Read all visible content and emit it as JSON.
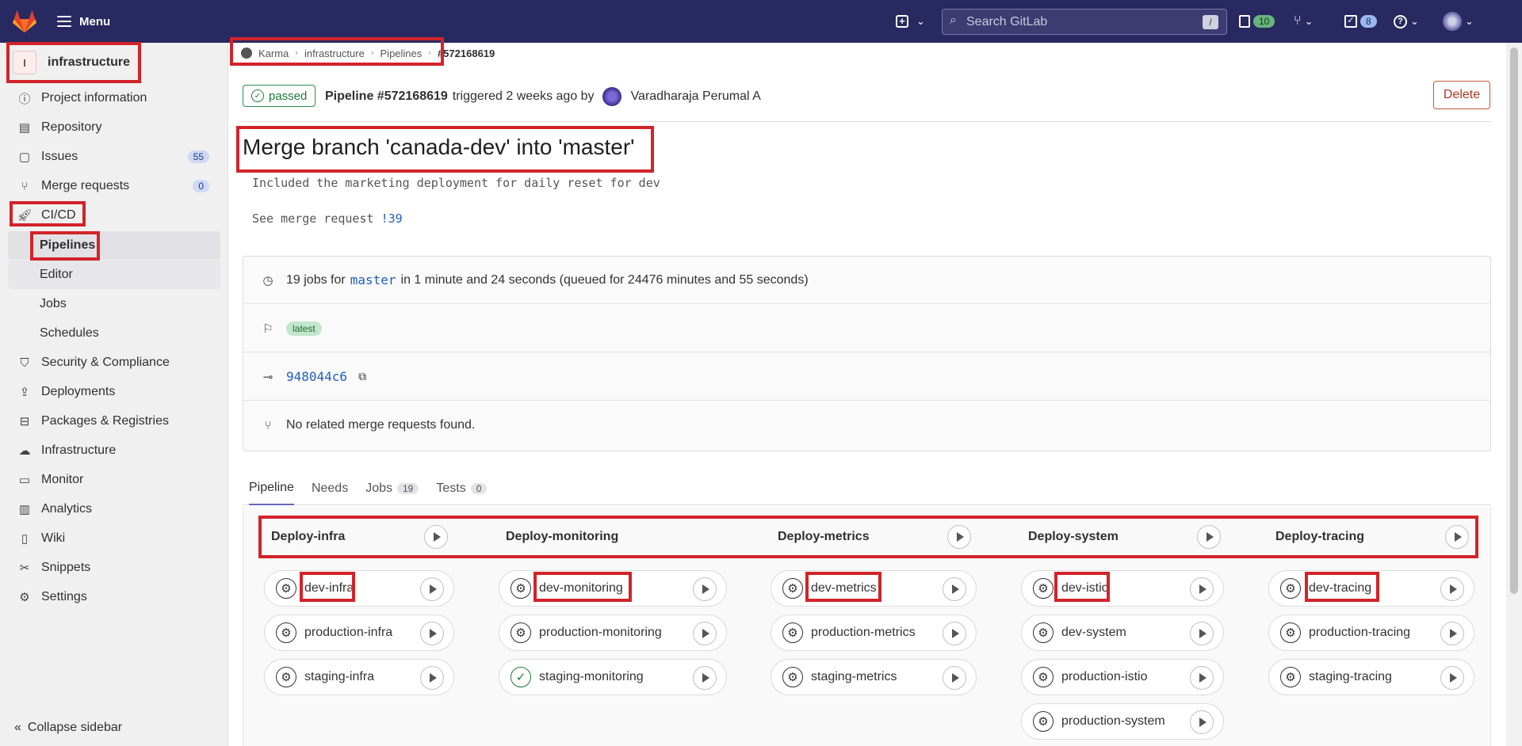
{
  "topbar": {
    "menu_label": "Menu",
    "search_placeholder": "Search GitLab",
    "search_shortcut": "/",
    "issues_count": "10",
    "todos_count": "8"
  },
  "sidebar": {
    "project_initial": "I",
    "project_name": "infrastructure",
    "items": [
      {
        "label": "Project information",
        "icon": "info-icon"
      },
      {
        "label": "Repository",
        "icon": "document-icon"
      },
      {
        "label": "Issues",
        "icon": "issues-icon",
        "count": "55"
      },
      {
        "label": "Merge requests",
        "icon": "merge-request-icon",
        "count": "0"
      },
      {
        "label": "CI/CD",
        "icon": "rocket-icon"
      }
    ],
    "cicd_sub": [
      "Pipelines",
      "Editor",
      "Jobs",
      "Schedules"
    ],
    "items2": [
      {
        "label": "Security & Compliance",
        "icon": "shield-icon"
      },
      {
        "label": "Deployments",
        "icon": "deployments-icon"
      },
      {
        "label": "Packages & Registries",
        "icon": "package-icon"
      },
      {
        "label": "Infrastructure",
        "icon": "cloud-icon"
      },
      {
        "label": "Monitor",
        "icon": "monitor-icon"
      },
      {
        "label": "Analytics",
        "icon": "chart-icon"
      },
      {
        "label": "Wiki",
        "icon": "book-icon"
      },
      {
        "label": "Snippets",
        "icon": "scissors-icon"
      },
      {
        "label": "Settings",
        "icon": "gear-icon"
      }
    ],
    "collapse_label": "Collapse sidebar"
  },
  "breadcrumb": [
    "Karma",
    "infrastructure",
    "Pipelines",
    "#572168619"
  ],
  "pipeline": {
    "status": "passed",
    "id_label": "Pipeline #572168619",
    "triggered_text": "triggered 2 weeks ago by",
    "user": "Varadharaja Perumal A",
    "delete_label": "Delete",
    "title": "Merge branch 'canada-dev' into 'master'",
    "desc_line1": "Included the marketing deployment for daily reset for dev",
    "desc_line2_prefix": "See merge request",
    "desc_line2_link": "!39",
    "jobs_prefix": "19 jobs for",
    "branch": "master",
    "jobs_suffix": "in 1 minute and 24 seconds (queued for 24476 minutes and 55 seconds)",
    "tag": "latest",
    "commit": "948044c6",
    "mr_text": "No related merge requests found."
  },
  "tabs": [
    {
      "label": "Pipeline",
      "count": ""
    },
    {
      "label": "Needs",
      "count": ""
    },
    {
      "label": "Jobs",
      "count": "19"
    },
    {
      "label": "Tests",
      "count": "0"
    }
  ],
  "stages": [
    {
      "name": "Deploy-infra",
      "jobs": [
        {
          "name": "dev-infra",
          "status": "manual"
        },
        {
          "name": "production-infra",
          "status": "manual"
        },
        {
          "name": "staging-infra",
          "status": "manual"
        }
      ]
    },
    {
      "name": "Deploy-monitoring",
      "jobs": [
        {
          "name": "dev-monitoring",
          "status": "manual"
        },
        {
          "name": "production-monitoring",
          "status": "manual"
        },
        {
          "name": "staging-monitoring",
          "status": "success"
        }
      ]
    },
    {
      "name": "Deploy-metrics",
      "jobs": [
        {
          "name": "dev-metrics",
          "status": "manual"
        },
        {
          "name": "production-metrics",
          "status": "manual"
        },
        {
          "name": "staging-metrics",
          "status": "manual"
        }
      ]
    },
    {
      "name": "Deploy-system",
      "jobs": [
        {
          "name": "dev-istio",
          "status": "manual"
        },
        {
          "name": "dev-system",
          "status": "manual"
        },
        {
          "name": "production-istio",
          "status": "manual"
        },
        {
          "name": "production-system",
          "status": "manual"
        }
      ]
    },
    {
      "name": "Deploy-tracing",
      "jobs": [
        {
          "name": "dev-tracing",
          "status": "manual"
        },
        {
          "name": "production-tracing",
          "status": "manual"
        },
        {
          "name": "staging-tracing",
          "status": "manual"
        }
      ]
    }
  ],
  "colors": {
    "topbar": "#292961",
    "highlight": "#d2232a",
    "success": "#1f7a3c",
    "link": "#1f5fbf"
  }
}
